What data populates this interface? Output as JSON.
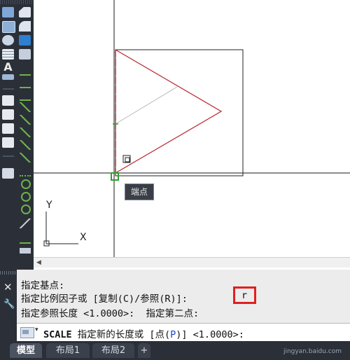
{
  "toolbar": {
    "left_icons": [
      "rectangle-icon",
      "hatch-icon",
      "circle-icon",
      "table-icon",
      "multiline-text-icon",
      "copy-icon",
      "copy-icon",
      "copy-icon",
      "copy-icon",
      "copy-icon",
      "layers-icon"
    ],
    "right_icons": [
      "fillet-icon",
      "fillet-icon",
      "explode-icon",
      "cube-icon",
      "snap-icon",
      "snap-icon",
      "snap-icon",
      "snap-icon",
      "snap-icon",
      "snap-icon",
      "snap-icon",
      "snap-icon",
      "snap-icon",
      "snap-icon",
      "snap-icon",
      "snap-icon",
      "snap-icon",
      "snap-icon",
      "snap-icon"
    ]
  },
  "canvas": {
    "tooltip": "端点",
    "ucs_x": "X",
    "ucs_y": "Y"
  },
  "command": {
    "history": [
      "指定基点:",
      "指定比例因子或 [复制(C)/参照(R)]: ",
      "指定参照长度 <1.0000>:  指定第二点:"
    ],
    "highlighted_input": "r",
    "current": {
      "command": "SCALE",
      "prompt": " 指定新的长度或 [点(",
      "option_key": "P",
      "suffix": ")] <1.0000>:"
    }
  },
  "tabs": [
    {
      "label": "模型",
      "active": true
    },
    {
      "label": "布局1",
      "active": false
    },
    {
      "label": "布局2",
      "active": false
    },
    {
      "label": "+",
      "active": false
    }
  ],
  "watermark": "jingyan.baidu.com"
}
